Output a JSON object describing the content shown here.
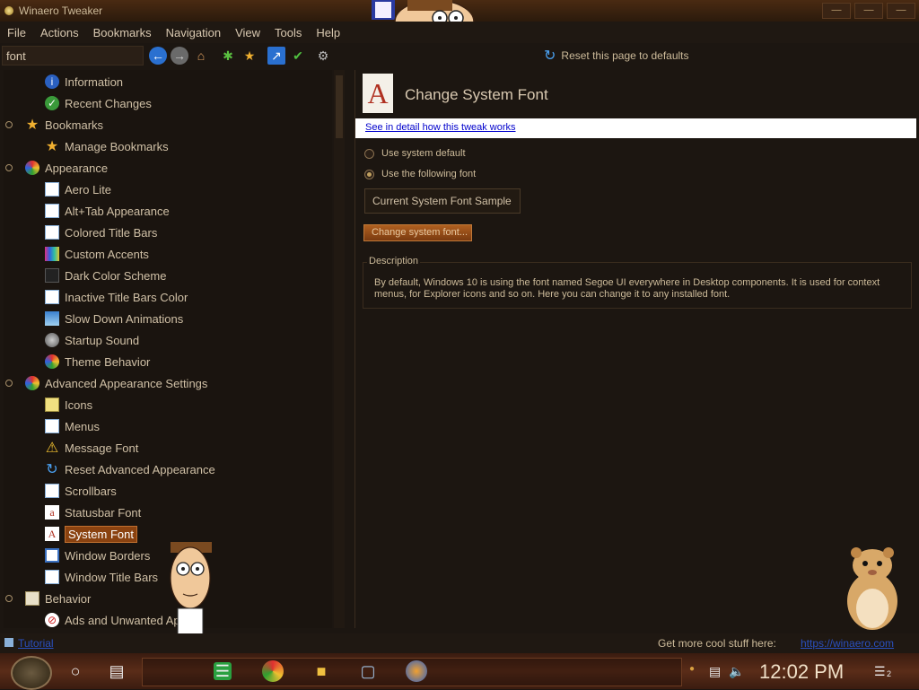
{
  "window": {
    "title": "Winaero Tweaker",
    "min": "––",
    "max": "––",
    "close": "––"
  },
  "menu": [
    "File",
    "Actions",
    "Bookmarks",
    "Navigation",
    "View",
    "Tools",
    "Help"
  ],
  "search": {
    "value": "font"
  },
  "reset_label": "Reset this page to defaults",
  "tree": [
    {
      "label": "Information",
      "icon": "info-icon"
    },
    {
      "label": "Recent Changes",
      "icon": "recent-icon"
    },
    {
      "label": "Bookmarks",
      "icon": "star-icon"
    },
    {
      "label": "Manage Bookmarks",
      "icon": "star-icon"
    },
    {
      "label": "Appearance",
      "icon": "appearance-icon"
    },
    {
      "label": "Aero Lite",
      "icon": "window-icon"
    },
    {
      "label": "Alt+Tab Appearance",
      "icon": "window-icon"
    },
    {
      "label": "Colored Title Bars",
      "icon": "window-icon"
    },
    {
      "label": "Custom Accents",
      "icon": "palette-icon"
    },
    {
      "label": "Dark Color Scheme",
      "icon": "window-icon"
    },
    {
      "label": "Inactive Title Bars Color",
      "icon": "window-icon"
    },
    {
      "label": "Slow Down Animations",
      "icon": "animation-icon"
    },
    {
      "label": "Startup Sound",
      "icon": "sound-icon"
    },
    {
      "label": "Theme Behavior",
      "icon": "theme-icon"
    },
    {
      "label": "Advanced Appearance Settings",
      "icon": "appearance-icon"
    },
    {
      "label": "Icons",
      "icon": "folder-icon"
    },
    {
      "label": "Menus",
      "icon": "window-icon"
    },
    {
      "label": "Message Font",
      "icon": "warning-icon"
    },
    {
      "label": "Reset Advanced Appearance",
      "icon": "refresh-icon"
    },
    {
      "label": "Scrollbars",
      "icon": "window-icon"
    },
    {
      "label": "Statusbar Font",
      "icon": "font-icon"
    },
    {
      "label": "System Font",
      "icon": "font-icon"
    },
    {
      "label": "Window Borders",
      "icon": "window-icon"
    },
    {
      "label": "Window Title Bars",
      "icon": "window-icon"
    },
    {
      "label": "Behavior",
      "icon": "behavior-icon"
    },
    {
      "label": "Ads and Unwanted Apps",
      "icon": "block-icon"
    }
  ],
  "page": {
    "title": "Change System Font",
    "detail_link": "See in detail how this tweak works",
    "radio_default": "Use system default",
    "radio_custom": "Use the following font",
    "sample": "Current System Font Sample",
    "change_button": "Change system font...",
    "desc_legend": "Description",
    "desc_text": "By default, Windows 10 is using the font named Segoe UI everywhere in Desktop components. It is used for context menus, for Explorer icons and so on. Here you can change it to any installed font."
  },
  "status": {
    "tutorial": "Tutorial",
    "cool": "Get more cool stuff here:",
    "url": "https://winaero.com"
  },
  "taskbar": {
    "clock": "12:02 PM",
    "notify_count": "2"
  },
  "colors": {
    "accent": "#8a4210",
    "background": "#1c1611",
    "text": "#d8c8b0"
  }
}
